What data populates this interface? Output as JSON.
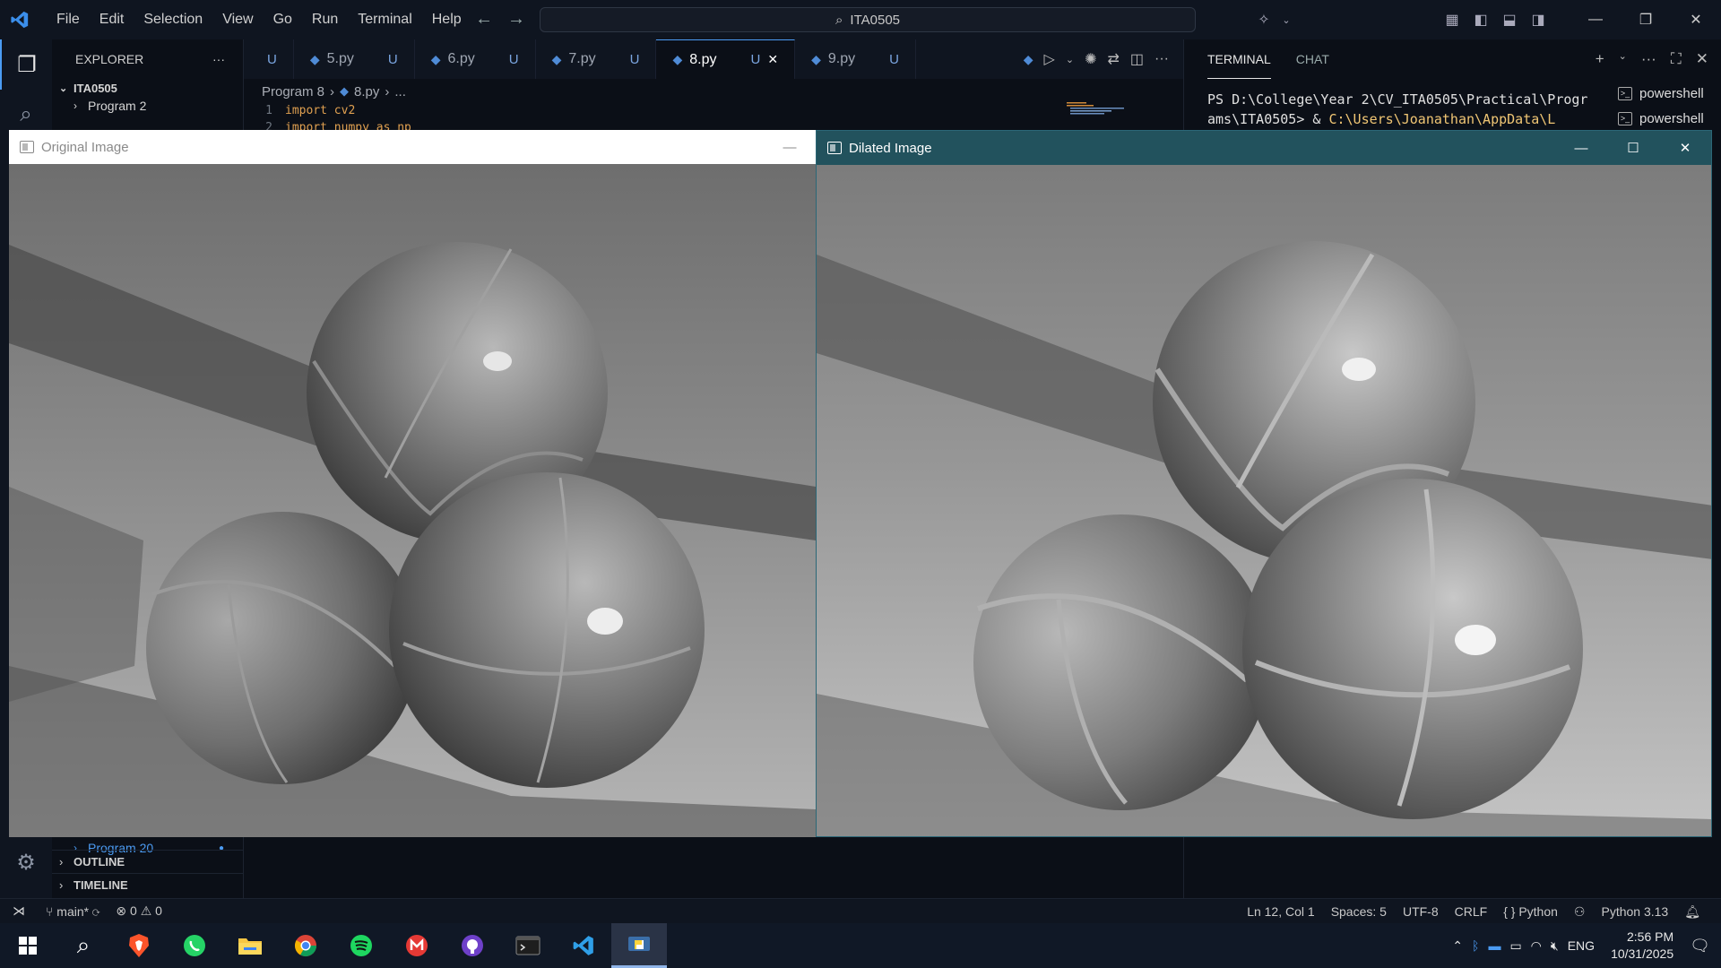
{
  "menu": [
    "File",
    "Edit",
    "Selection",
    "View",
    "Go",
    "Run",
    "Terminal",
    "Help"
  ],
  "search": {
    "label": "ITA0505"
  },
  "explorer": {
    "title": "EXPLORER",
    "workspace": "ITA0505",
    "folders": [
      "Program 2",
      "Program 20"
    ],
    "outline_label": "OUTLINE",
    "timeline_label": "TIMELINE"
  },
  "tabs": [
    {
      "label": "",
      "badge": "U"
    },
    {
      "label": "5.py",
      "badge": "U"
    },
    {
      "label": "6.py",
      "badge": "U"
    },
    {
      "label": "7.py",
      "badge": "U"
    },
    {
      "label": "8.py",
      "badge": "U",
      "active": true
    },
    {
      "label": "9.py",
      "badge": "U"
    }
  ],
  "breadcrumb": {
    "folder": "Program 8",
    "file": "8.py",
    "tail": "..."
  },
  "code": [
    {
      "n": "1",
      "text": "import cv2"
    },
    {
      "n": "2",
      "text": "import numpy as np"
    }
  ],
  "panel": {
    "tabs": [
      "TERMINAL",
      "CHAT"
    ],
    "terminal_prompt": "PS D:\\College\\Year 2\\CV_ITA0505\\Practical\\Programs\\ITA0505> & ",
    "terminal_path": "C:\\Users\\Joanathan\\AppData\\L",
    "terminals": [
      "powershell",
      "powershell"
    ]
  },
  "windows": {
    "original": {
      "title": "Original Image"
    },
    "dilated": {
      "title": "Dilated Image"
    }
  },
  "status": {
    "branch": "main*",
    "errors": "0",
    "warnings": "0",
    "cursor": "Ln 12, Col 1",
    "spaces": "Spaces: 5",
    "encoding": "UTF-8",
    "eol": "CRLF",
    "language": "Python",
    "interpreter": "Python 3.13"
  },
  "taskbar": {
    "lang": "ENG",
    "time": "2:56 PM",
    "date": "10/31/2025",
    "apps": [
      "start-icon",
      "search-icon",
      "brave-icon",
      "whatsapp-icon",
      "file-explorer-icon",
      "chrome-icon",
      "spotify-icon",
      "gmail-icon",
      "github-icon",
      "terminal-icon",
      "vscode-icon",
      "python-icon"
    ]
  },
  "colors": {
    "accent": "#4b9bf2",
    "dilated_title_bg": "#22525d",
    "keyword": "#e0a050",
    "terminal_path": "#f0c674"
  }
}
